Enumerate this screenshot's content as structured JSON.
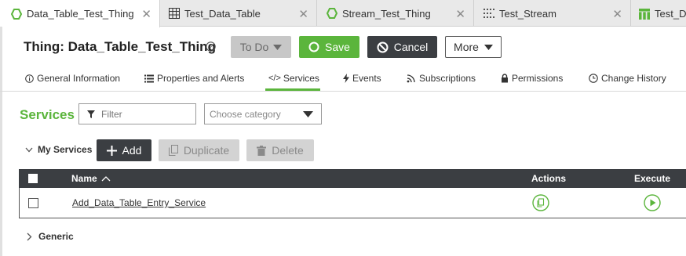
{
  "tabs": [
    {
      "label": "Data_Table_Test_Thing",
      "icon": "thing-hexagon-icon",
      "active": true
    },
    {
      "label": "Test_Data_Table",
      "icon": "data-table-icon",
      "active": false
    },
    {
      "label": "Stream_Test_Thing",
      "icon": "thing-hexagon-icon",
      "active": false
    },
    {
      "label": "Test_Stream",
      "icon": "stream-icon",
      "active": false
    },
    {
      "label": "Test_Da",
      "icon": "data-table-green-icon",
      "active": false
    }
  ],
  "header": {
    "title": "Thing: Data_Table_Test_Thing",
    "todo_label": "To Do",
    "save_label": "Save",
    "cancel_label": "Cancel",
    "more_label": "More"
  },
  "subnav": [
    {
      "label": "General Information",
      "icon": "info-icon"
    },
    {
      "label": "Properties and Alerts",
      "icon": "list-icon"
    },
    {
      "label": "Services",
      "icon": "code-icon",
      "active": true
    },
    {
      "label": "Events",
      "icon": "lightning-icon"
    },
    {
      "label": "Subscriptions",
      "icon": "subscription-icon"
    },
    {
      "label": "Permissions",
      "icon": "lock-icon"
    },
    {
      "label": "Change History",
      "icon": "clock-icon"
    }
  ],
  "services": {
    "title": "Services",
    "filter_placeholder": "Filter",
    "category_placeholder": "Choose category",
    "my_services_label": "My Services",
    "add_label": "Add",
    "duplicate_label": "Duplicate",
    "delete_label": "Delete",
    "generic_label": "Generic"
  },
  "table": {
    "columns": {
      "name": "Name",
      "actions": "Actions",
      "execute": "Execute"
    },
    "rows": [
      {
        "name": "Add_Data_Table_Entry_Service"
      }
    ]
  },
  "colors": {
    "accent_green": "#5bb53c",
    "dark": "#3b3e42"
  }
}
